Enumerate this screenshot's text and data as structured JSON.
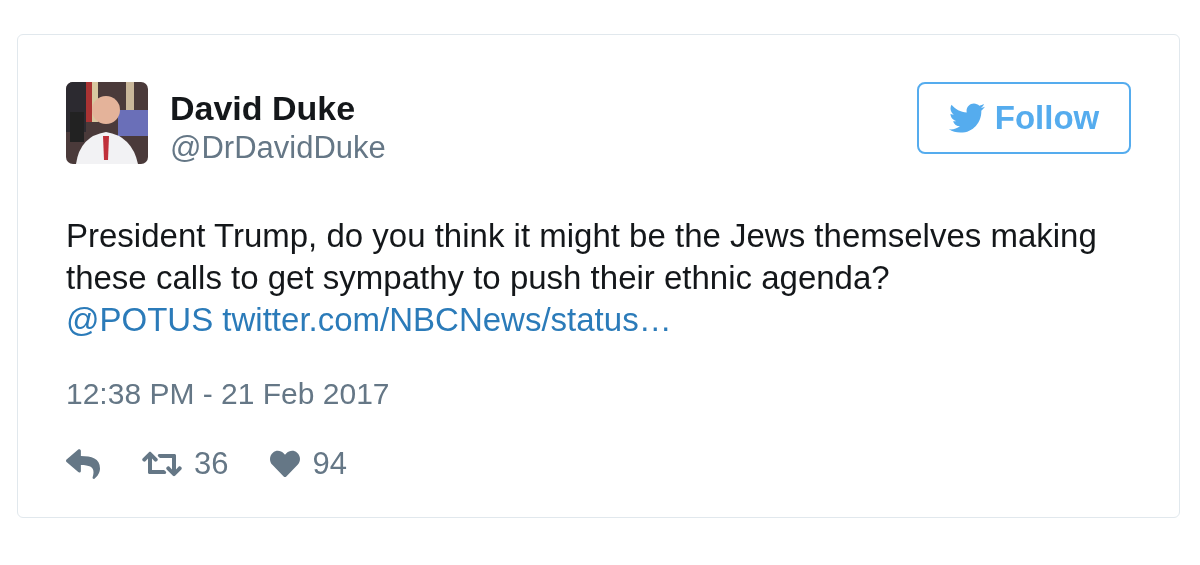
{
  "author": {
    "name": "David Duke",
    "handle": "@DrDavidDuke"
  },
  "follow_button": {
    "label": "Follow"
  },
  "tweet": {
    "text": "President Trump, do you think it might be the Jews themselves making these calls to get sympathy to push their ethnic agenda?",
    "links": [
      "@POTUS",
      "twitter.com/NBCNews/status…"
    ]
  },
  "timestamp": "12:38 PM - 21 Feb 2017",
  "actions": [
    {
      "kind": "reply"
    },
    {
      "kind": "retweet",
      "count": "36"
    },
    {
      "kind": "like",
      "count": "94"
    }
  ]
}
